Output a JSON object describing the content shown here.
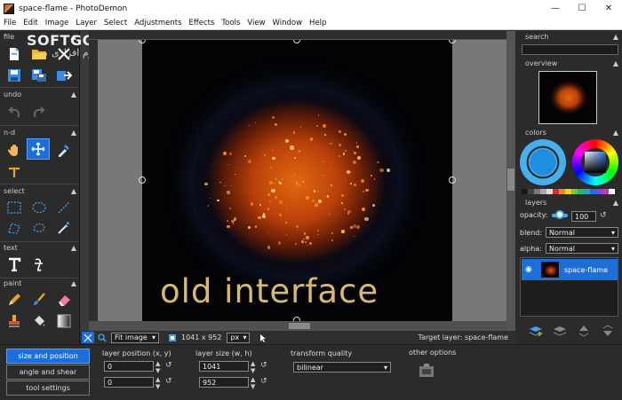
{
  "window": {
    "title": "space-flame - PhotoDemon",
    "minimize": "—",
    "maximize": "☐",
    "close": "✕"
  },
  "menu": [
    "File",
    "Edit",
    "Image",
    "Layer",
    "Select",
    "Adjustments",
    "Effects",
    "Tools",
    "View",
    "Window",
    "Help"
  ],
  "watermark": {
    "logo": "SOFTGOZAR.COM",
    "tagline": "اولین دانشنامه نرم افزاری"
  },
  "toolbox": {
    "sections": {
      "file": "file",
      "undo": "undo",
      "nd": "n-d",
      "select": "select",
      "text": "text",
      "paint": "paint"
    }
  },
  "canvas": {
    "overlay_text": "old interface"
  },
  "statusbar": {
    "zoom_option": "Fit image",
    "image_size": "1041 x 952",
    "unit": "px",
    "target_layer": "Target layer: space-flame"
  },
  "right": {
    "search_title": "search",
    "overview_title": "overview",
    "colors_title": "colors",
    "layers_title": "layers",
    "opacity_label": "opacity:",
    "opacity_value": "100",
    "blend_label": "blend:",
    "blend_value": "Normal",
    "alpha_label": "alpha:",
    "alpha_value": "Normal",
    "layer_name": "space-flame"
  },
  "bottom": {
    "tabs": [
      "size and position",
      "angle and shear",
      "tool settings"
    ],
    "layer_position_label": "layer position (x, y)",
    "pos_x": "0",
    "pos_y": "0",
    "layer_size_label": "layer size (w, h)",
    "size_w": "1041",
    "size_h": "952",
    "transform_quality_label": "transform quality",
    "transform_quality_value": "bilinear",
    "other_options_label": "other options"
  },
  "colors": {
    "accent": "#1c6ed8",
    "panel_bg": "#2b2b2b",
    "canvas_bg": "#787878",
    "text_gold": "#d9b870"
  },
  "palette": [
    "#1a1a1a",
    "#444444",
    "#777777",
    "#aaaaaa",
    "#dddddd",
    "#cc3333",
    "#e8842a",
    "#e8d42a",
    "#7cc432",
    "#2ab46c",
    "#2aa4c4",
    "#2a6bd8",
    "#7a4ad8",
    "#c43ab4",
    "#ffffff"
  ]
}
